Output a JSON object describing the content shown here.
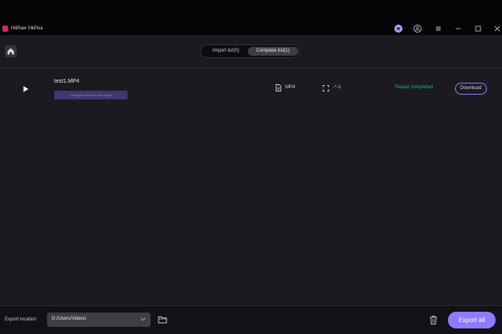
{
  "app": {
    "title": "HitPaw VikPea"
  },
  "titlebar_icons": [
    "cart-icon",
    "user-icon",
    "menu-icon",
    "minimize-icon",
    "maximize-icon",
    "close-icon"
  ],
  "tabs": [
    {
      "label": "Import list(0)",
      "active": false
    },
    {
      "label": "Complete list(1)",
      "active": true
    }
  ],
  "files": [
    {
      "name": "test1.MP4",
      "tag": "Intelligent detection and repair",
      "format": "MP4",
      "resolution": "-*-1",
      "status": "Repair completed",
      "action": "Download"
    }
  ],
  "footer": {
    "export_location_label": "Export location",
    "path": "D:/Users/Videos",
    "export_all_label": "Export all"
  },
  "colors": {
    "accent": "#8c7cff",
    "success": "#16b886",
    "tag_bg": "#3f3672",
    "background": "#1b1a20"
  }
}
